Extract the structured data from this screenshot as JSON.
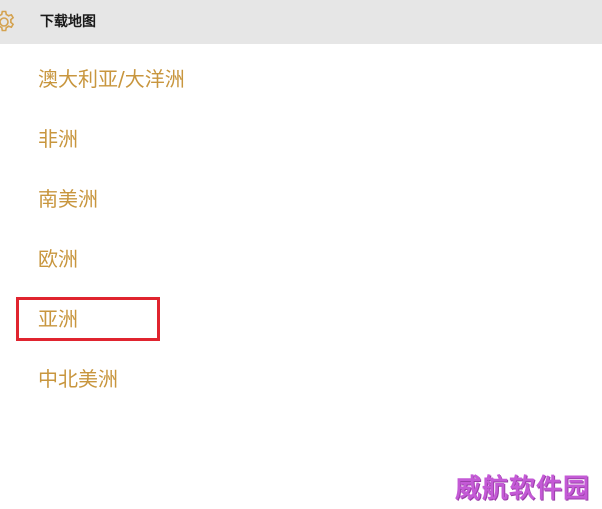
{
  "header": {
    "title": "下载地图",
    "icon": "gear-icon"
  },
  "regions": [
    {
      "label": "澳大利亚/大洋洲"
    },
    {
      "label": "非洲"
    },
    {
      "label": "南美洲"
    },
    {
      "label": "欧洲"
    },
    {
      "label": "亚洲"
    },
    {
      "label": "中北美洲"
    }
  ],
  "highlight": {
    "target": "亚洲",
    "color": "#e0242f"
  },
  "watermark": {
    "text": "威航软件园"
  },
  "colors": {
    "header_bg": "#e6e6e6",
    "accent": "#c8963e",
    "gear": "#d4a24f"
  }
}
